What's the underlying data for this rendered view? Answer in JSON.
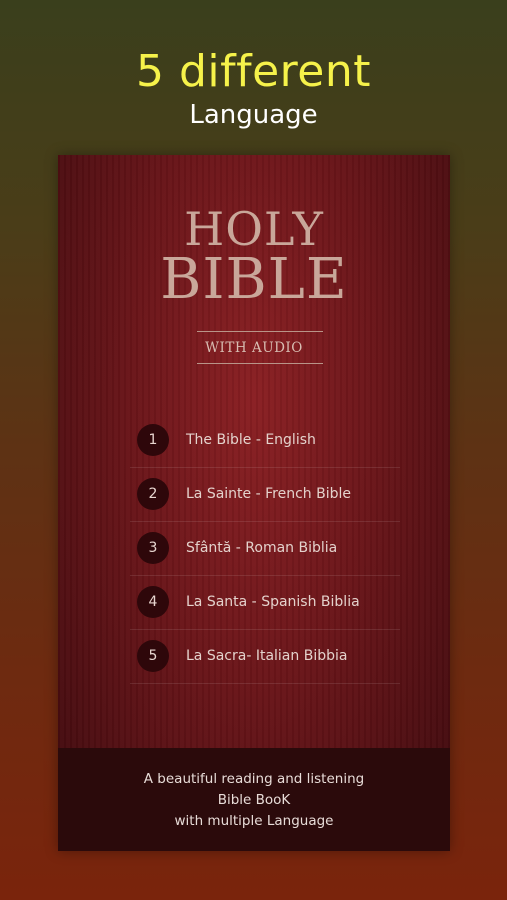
{
  "promo": {
    "headline": "5 different",
    "subheadline": "Language"
  },
  "app": {
    "title_line1": "HOLY",
    "title_line2": "BIBLE",
    "subtitle": "WITH AUDIO",
    "languages": [
      {
        "number": "1",
        "label": "The Bible - English"
      },
      {
        "number": "2",
        "label": "La Sainte - French Bible"
      },
      {
        "number": "3",
        "label": "Sfântă - Roman Biblia"
      },
      {
        "number": "4",
        "label": "La Santa - Spanish Biblia"
      },
      {
        "number": "5",
        "label": "La Sacra- Italian Bibbia"
      }
    ],
    "footer": {
      "line1": "A beautiful reading and listening",
      "line2": "Bible BooK",
      "line3": "with multiple Language"
    }
  },
  "colors": {
    "headline": "#f6f24a",
    "title": "#c9a79a",
    "panel": "#6a1519",
    "footer_bg": "#2b0a0b"
  }
}
